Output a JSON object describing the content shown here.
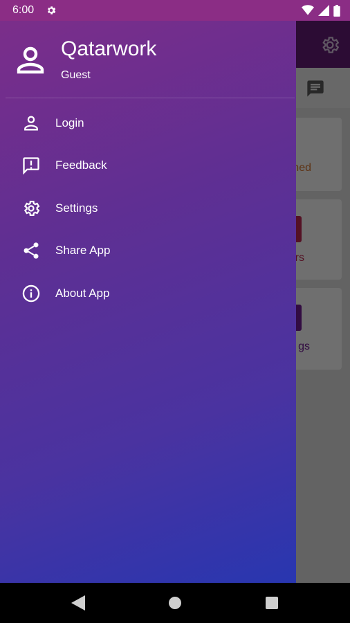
{
  "status_bar": {
    "time": "6:00",
    "icons": [
      "settings-icon",
      "wifi-icon",
      "signal-icon",
      "battery-icon"
    ]
  },
  "drawer": {
    "app_name": "Qatarwork",
    "user_role": "Guest",
    "avatar_icon": "person-icon",
    "items": [
      {
        "label": "Login",
        "icon": "person-outline-icon"
      },
      {
        "label": "Feedback",
        "icon": "feedback-icon"
      },
      {
        "label": "Settings",
        "icon": "gear-icon"
      },
      {
        "label": "Share App",
        "icon": "share-icon"
      },
      {
        "label": "About App",
        "icon": "info-icon"
      }
    ]
  },
  "background_app": {
    "card_texts": [
      "ned",
      "rs",
      "gs"
    ],
    "colors": {
      "toolbar": "#5c1b6e",
      "accent_orange": "#c46b2a",
      "accent_red": "#b0244b",
      "accent_purple": "#6a1b8a"
    }
  },
  "nav_bar": {
    "buttons": [
      "back-icon",
      "home-icon",
      "recents-icon"
    ]
  },
  "colors": {
    "drawer_gradient_start": "#7b2e8a",
    "drawer_gradient_end": "#2836b0",
    "status_bar": "#8b2d85"
  }
}
